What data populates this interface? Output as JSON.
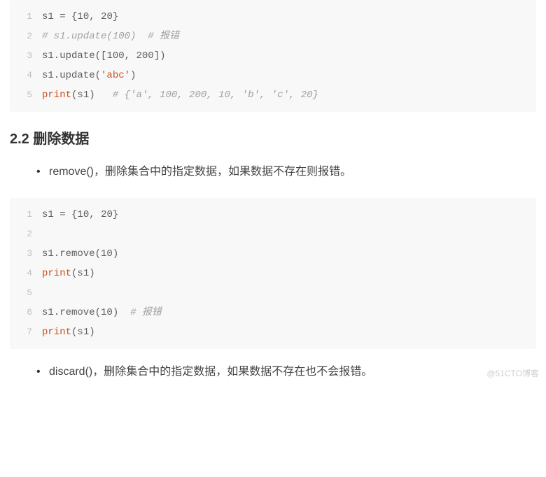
{
  "code1": {
    "lines": [
      [
        {
          "cls": "tk-default",
          "t": "s1 "
        },
        {
          "cls": "tk-punct",
          "t": "= {"
        },
        {
          "cls": "tk-number",
          "t": "10"
        },
        {
          "cls": "tk-punct",
          "t": ", "
        },
        {
          "cls": "tk-number",
          "t": "20"
        },
        {
          "cls": "tk-punct",
          "t": "}"
        }
      ],
      [
        {
          "cls": "tk-comment",
          "t": "# s1.update(100)  # 报错"
        }
      ],
      [
        {
          "cls": "tk-default",
          "t": "s1.update"
        },
        {
          "cls": "tk-punct",
          "t": "(["
        },
        {
          "cls": "tk-number",
          "t": "100"
        },
        {
          "cls": "tk-punct",
          "t": ", "
        },
        {
          "cls": "tk-number",
          "t": "200"
        },
        {
          "cls": "tk-punct",
          "t": "])"
        }
      ],
      [
        {
          "cls": "tk-default",
          "t": "s1.update"
        },
        {
          "cls": "tk-punct",
          "t": "("
        },
        {
          "cls": "tk-string",
          "t": "'abc'"
        },
        {
          "cls": "tk-punct",
          "t": ")"
        }
      ],
      [
        {
          "cls": "tk-builtin",
          "t": "print"
        },
        {
          "cls": "tk-punct",
          "t": "("
        },
        {
          "cls": "tk-default",
          "t": "s1"
        },
        {
          "cls": "tk-punct",
          "t": ")   "
        },
        {
          "cls": "tk-comment",
          "t": "# {'a', 100, 200, 10, 'b', 'c', 20}"
        }
      ]
    ]
  },
  "heading": "2.2 删除数据",
  "bullet1": {
    "method": "remove()",
    "desc": "，删除集合中的指定数据，如果数据不存在则报错。"
  },
  "code2": {
    "lines": [
      [
        {
          "cls": "tk-default",
          "t": "s1 "
        },
        {
          "cls": "tk-punct",
          "t": "= {"
        },
        {
          "cls": "tk-number",
          "t": "10"
        },
        {
          "cls": "tk-punct",
          "t": ", "
        },
        {
          "cls": "tk-number",
          "t": "20"
        },
        {
          "cls": "tk-punct",
          "t": "}"
        }
      ],
      [],
      [
        {
          "cls": "tk-default",
          "t": "s1.remove"
        },
        {
          "cls": "tk-punct",
          "t": "("
        },
        {
          "cls": "tk-number",
          "t": "10"
        },
        {
          "cls": "tk-punct",
          "t": ")"
        }
      ],
      [
        {
          "cls": "tk-builtin",
          "t": "print"
        },
        {
          "cls": "tk-punct",
          "t": "("
        },
        {
          "cls": "tk-default",
          "t": "s1"
        },
        {
          "cls": "tk-punct",
          "t": ")"
        }
      ],
      [],
      [
        {
          "cls": "tk-default",
          "t": "s1.remove"
        },
        {
          "cls": "tk-punct",
          "t": "("
        },
        {
          "cls": "tk-number",
          "t": "10"
        },
        {
          "cls": "tk-punct",
          "t": ")  "
        },
        {
          "cls": "tk-comment",
          "t": "# 报错"
        }
      ],
      [
        {
          "cls": "tk-builtin",
          "t": "print"
        },
        {
          "cls": "tk-punct",
          "t": "("
        },
        {
          "cls": "tk-default",
          "t": "s1"
        },
        {
          "cls": "tk-punct",
          "t": ")"
        }
      ]
    ]
  },
  "bullet2": {
    "method": "discard()",
    "desc": "，删除集合中的指定数据，如果数据不存在也不会报错。"
  },
  "watermark": "@51CTO博客"
}
